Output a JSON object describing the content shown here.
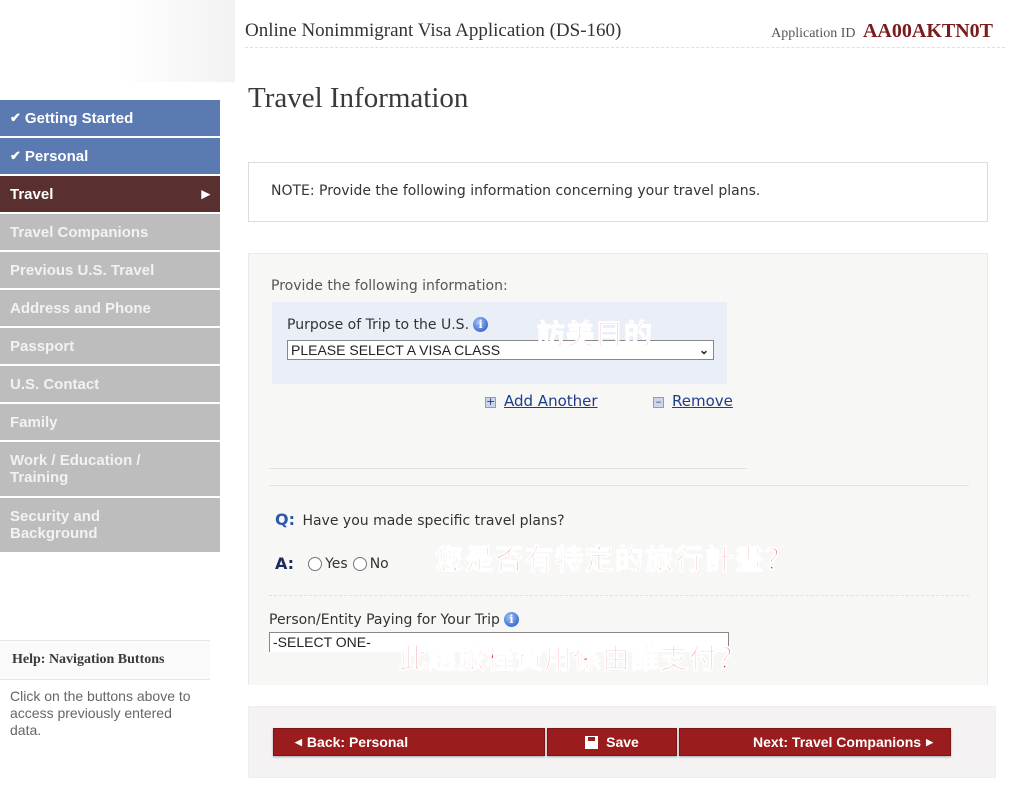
{
  "header": {
    "title": "Online Nonimmigrant Visa Application (DS-160)",
    "application_id_label": "Application ID",
    "application_id": "AA00AKTN0T"
  },
  "sidebar": {
    "items": [
      {
        "label": "Getting Started",
        "state": "done"
      },
      {
        "label": "Personal",
        "state": "done"
      },
      {
        "label": "Travel",
        "state": "current"
      },
      {
        "label": "Travel Companions",
        "state": "todo"
      },
      {
        "label": "Previous U.S. Travel",
        "state": "todo"
      },
      {
        "label": "Address and Phone",
        "state": "todo"
      },
      {
        "label": "Passport",
        "state": "todo"
      },
      {
        "label": "U.S. Contact",
        "state": "todo"
      },
      {
        "label": "Family",
        "state": "todo"
      },
      {
        "label": "Work / Education / Training",
        "state": "todo"
      },
      {
        "label": "Security and Background",
        "state": "todo"
      }
    ],
    "help": {
      "title": "Help: Navigation Buttons",
      "text": "Click on the buttons above to access previously entered data."
    }
  },
  "main": {
    "page_title": "Travel Information",
    "note": "NOTE: Provide the following information concerning your travel plans.",
    "section_label": "Provide the following information:",
    "purpose": {
      "label": "Purpose of Trip to the U.S.",
      "selected": "PLEASE SELECT A VISA CLASS",
      "annotation": "訪美目的"
    },
    "add_another": "Add Another",
    "remove": "Remove",
    "travel_plans": {
      "q_prefix": "Q:",
      "question": "Have you made specific travel plans?",
      "a_prefix": "A:",
      "option_yes": "Yes",
      "option_no": "No",
      "annotation": "您是否有特定的旅行計畫？"
    },
    "payer": {
      "label": "Person/Entity Paying for Your Trip",
      "selected": "-SELECT ONE-",
      "annotation": "此趟旅程費用係由誰支付？"
    }
  },
  "buttons": {
    "back": "Back: Personal",
    "save": "Save",
    "next": "Next: Travel Companions"
  },
  "colors": {
    "nav_done": "#5a7ab1",
    "nav_current": "#5a2f2f",
    "nav_todo": "#bdbdbd",
    "button": "#9b1c1c",
    "annotation": "#e8323c",
    "app_id": "#7a1c1c"
  },
  "icons": {
    "check": "check-icon",
    "arrow_right": "arrow-right-icon",
    "info": "info-icon",
    "plus": "plus-icon",
    "minus": "minus-icon",
    "save": "save-icon",
    "chevron_down": "chevron-down-icon"
  }
}
